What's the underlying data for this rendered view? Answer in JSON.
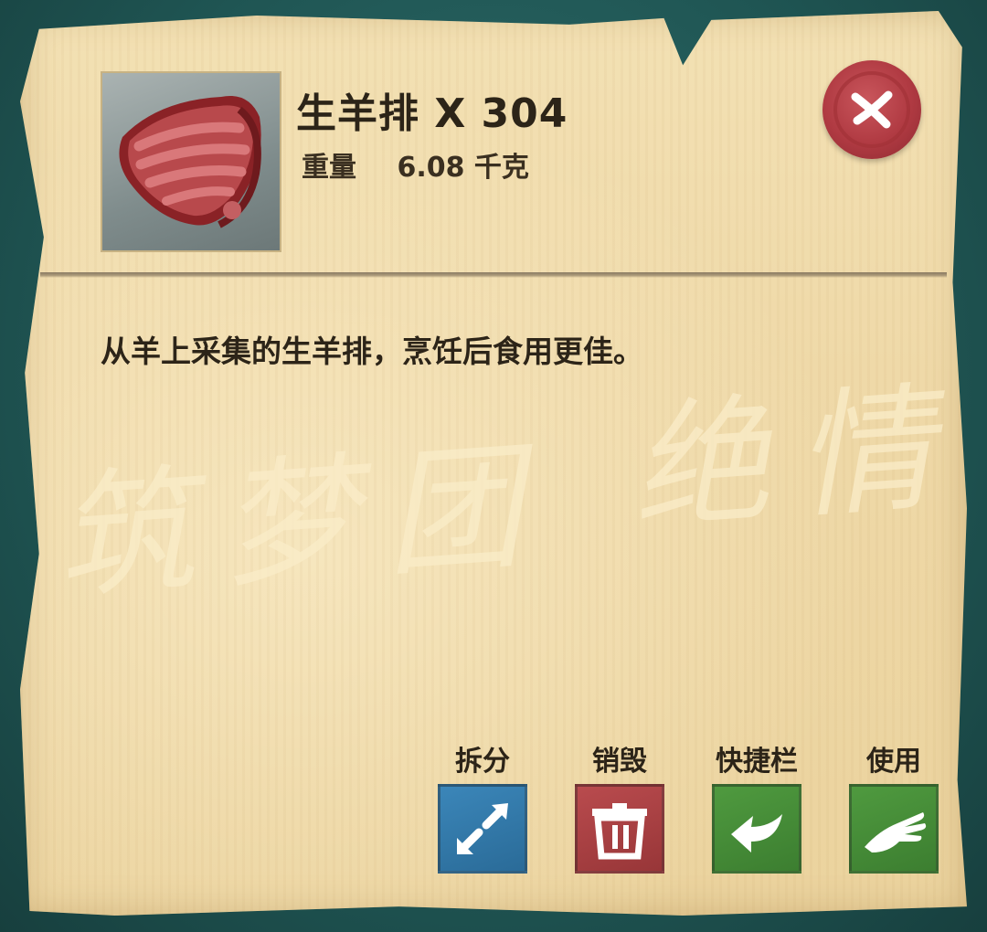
{
  "item": {
    "name_line": "生羊排 X 304",
    "weight_label": "重量",
    "weight_value": "6.08 千克",
    "description": "从羊上采集的生羊排，烹饪后食用更佳。",
    "icon": "raw-mutton-chop-icon"
  },
  "watermark": {
    "left": "筑梦团",
    "right": "绝情"
  },
  "close": {
    "icon": "wax-seal-close-icon"
  },
  "actions": [
    {
      "label": "拆分",
      "icon": "split-arrows-icon",
      "color": "#2f77a8"
    },
    {
      "label": "销毁",
      "icon": "trash-icon",
      "color": "#a8403f"
    },
    {
      "label": "快捷栏",
      "icon": "arrow-left-icon",
      "color": "#438a35"
    },
    {
      "label": "使用",
      "icon": "hand-icon",
      "color": "#438a35"
    }
  ],
  "colors": {
    "parchment": "#efd9a8",
    "text": "#2c2418",
    "background": "#1f5553"
  }
}
